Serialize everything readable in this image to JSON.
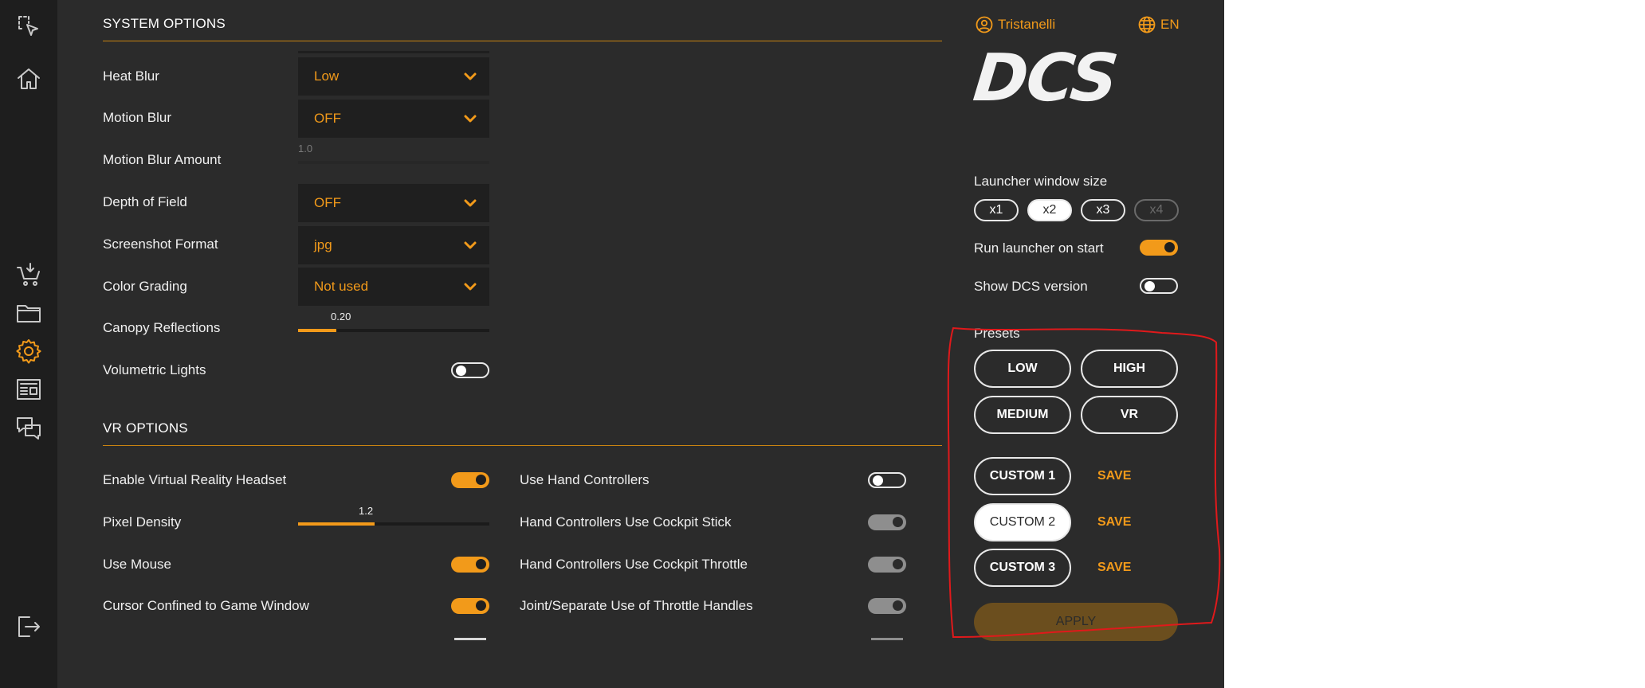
{
  "system_options": {
    "title": "SYSTEM OPTIONS",
    "heat_blur": {
      "label": "Heat Blur",
      "value": "Low"
    },
    "motion_blur": {
      "label": "Motion Blur",
      "value": "OFF"
    },
    "motion_blur_amount": {
      "label": "Motion Blur Amount",
      "value": "1.0",
      "level": 0
    },
    "depth_of_field": {
      "label": "Depth of Field",
      "value": "OFF"
    },
    "screenshot_format": {
      "label": "Screenshot Format",
      "value": "jpg"
    },
    "color_grading": {
      "label": "Color Grading",
      "value": "Not used"
    },
    "canopy_reflections": {
      "label": "Canopy Reflections",
      "value": "0.20",
      "level": 0.2
    },
    "volumetric_lights": {
      "label": "Volumetric Lights",
      "state": "off"
    }
  },
  "vr_options": {
    "title": "VR OPTIONS",
    "enable_vr_headset": {
      "label": "Enable Virtual Reality Headset",
      "state": "on"
    },
    "pixel_density": {
      "label": "Pixel Density",
      "value": "1.2",
      "level": 0.4
    },
    "use_mouse": {
      "label": "Use Mouse",
      "state": "on"
    },
    "cursor_confined": {
      "label": "Cursor Confined to Game Window",
      "state": "on"
    },
    "use_hand_controllers": {
      "label": "Use Hand Controllers",
      "state": "off"
    },
    "hc_cockpit_stick": {
      "label": "Hand Controllers Use Cockpit Stick",
      "state": "disabled"
    },
    "hc_cockpit_throttle": {
      "label": "Hand Controllers Use Cockpit Throttle",
      "state": "disabled"
    },
    "joint_separate_throttle": {
      "label": "Joint/Separate Use of Throttle Handles",
      "state": "disabled"
    }
  },
  "header": {
    "username": "Tristanelli",
    "language": "EN",
    "logo_text": "DCS"
  },
  "launcher": {
    "window_size_label": "Launcher window size",
    "sizes": [
      "x1",
      "x2",
      "x3",
      "x4"
    ],
    "selected_size": "x2",
    "disabled_size": "x4",
    "run_on_start_label": "Run launcher on start",
    "run_on_start": "on",
    "show_version_label": "Show DCS version",
    "show_version": "off"
  },
  "presets": {
    "label": "Presets",
    "buttons": [
      "LOW",
      "HIGH",
      "MEDIUM",
      "VR"
    ],
    "custom": [
      "CUSTOM 1",
      "CUSTOM 2",
      "CUSTOM 3"
    ],
    "selected_custom": "CUSTOM 2",
    "save_label": "SAVE",
    "apply_label": "APPLY"
  },
  "nav_icons": [
    "select-area-icon",
    "home-icon",
    "download-cart-icon",
    "folder-icon",
    "gear-icon",
    "news-icon",
    "chat-icon",
    "logout-icon"
  ],
  "colors": {
    "accent": "#f29a1a",
    "background": "#2b2b2b",
    "sidebar": "#1e1e1e",
    "annotation": "#e0191b"
  }
}
